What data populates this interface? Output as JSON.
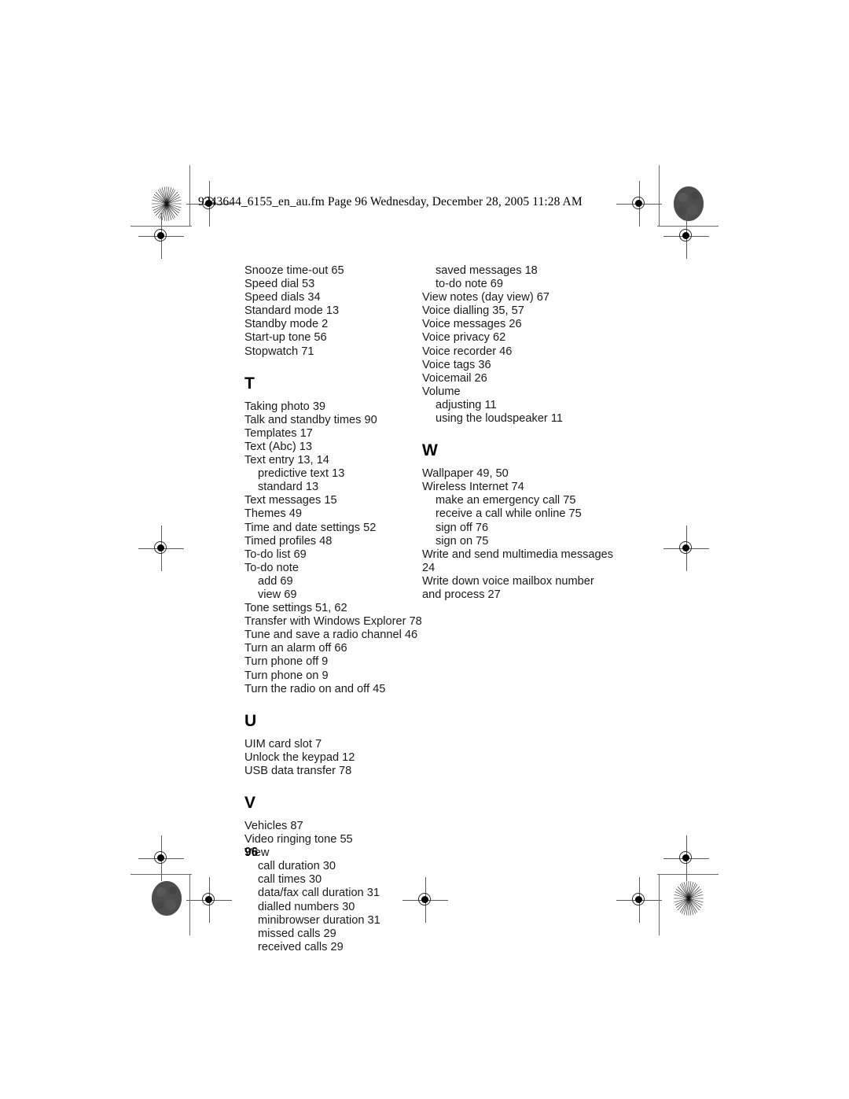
{
  "slug": "9243644_6155_en_au.fm  Page 96  Wednesday, December 28, 2005  11:28 AM",
  "folio": "96",
  "columns": {
    "left": [
      {
        "type": "entry",
        "text": "Snooze time-out 65"
      },
      {
        "type": "entry",
        "text": "Speed dial 53"
      },
      {
        "type": "entry",
        "text": "Speed dials 34"
      },
      {
        "type": "entry",
        "text": "Standard mode 13"
      },
      {
        "type": "entry",
        "text": "Standby mode 2"
      },
      {
        "type": "entry",
        "text": "Start-up tone 56"
      },
      {
        "type": "entry",
        "text": "Stopwatch 71"
      },
      {
        "type": "heading",
        "text": "T"
      },
      {
        "type": "entry",
        "text": "Taking photo 39"
      },
      {
        "type": "entry",
        "text": "Talk and standby times 90"
      },
      {
        "type": "entry",
        "text": "Templates 17"
      },
      {
        "type": "entry",
        "text": "Text (Abc) 13"
      },
      {
        "type": "entry",
        "text": "Text entry 13, 14"
      },
      {
        "type": "sub",
        "text": "predictive text 13"
      },
      {
        "type": "sub",
        "text": "standard 13"
      },
      {
        "type": "entry",
        "text": "Text messages 15"
      },
      {
        "type": "entry",
        "text": "Themes 49"
      },
      {
        "type": "entry",
        "text": "Time and date settings 52"
      },
      {
        "type": "entry",
        "text": "Timed profiles 48"
      },
      {
        "type": "entry",
        "text": "To-do list 69"
      },
      {
        "type": "entry",
        "text": "To-do note"
      },
      {
        "type": "sub",
        "text": "add 69"
      },
      {
        "type": "sub",
        "text": "view 69"
      },
      {
        "type": "entry",
        "text": "Tone settings 51, 62"
      },
      {
        "type": "entry",
        "text": "Transfer with Windows Explorer 78"
      },
      {
        "type": "entry",
        "text": "Tune and save a radio channel 46"
      },
      {
        "type": "entry",
        "text": "Turn an alarm off 66"
      },
      {
        "type": "entry",
        "text": "Turn phone off 9"
      },
      {
        "type": "entry",
        "text": "Turn phone on 9"
      },
      {
        "type": "entry",
        "text": "Turn the radio on and off 45"
      },
      {
        "type": "heading",
        "text": "U"
      },
      {
        "type": "entry",
        "text": "UIM card slot 7"
      },
      {
        "type": "entry",
        "text": "Unlock the keypad 12"
      },
      {
        "type": "entry",
        "text": "USB data transfer 78"
      },
      {
        "type": "heading",
        "text": "V"
      },
      {
        "type": "entry",
        "text": "Vehicles 87"
      },
      {
        "type": "entry",
        "text": "Video ringing tone 55"
      },
      {
        "type": "entry",
        "text": "View"
      },
      {
        "type": "sub",
        "text": "call duration 30"
      },
      {
        "type": "sub",
        "text": "call times 30"
      },
      {
        "type": "sub",
        "text": "data/fax call duration 31"
      },
      {
        "type": "sub",
        "text": "dialled numbers 30"
      },
      {
        "type": "sub",
        "text": "minibrowser duration 31"
      },
      {
        "type": "sub",
        "text": "missed calls 29"
      },
      {
        "type": "sub",
        "text": "received calls 29"
      }
    ],
    "right": [
      {
        "type": "sub",
        "text": "saved messages 18"
      },
      {
        "type": "sub",
        "text": "to-do note 69"
      },
      {
        "type": "entry",
        "text": "View notes (day view) 67"
      },
      {
        "type": "entry",
        "text": "Voice dialling 35, 57"
      },
      {
        "type": "entry",
        "text": "Voice messages 26"
      },
      {
        "type": "entry",
        "text": "Voice privacy 62"
      },
      {
        "type": "entry",
        "text": "Voice recorder 46"
      },
      {
        "type": "entry",
        "text": "Voice tags 36"
      },
      {
        "type": "entry",
        "text": "Voicemail 26"
      },
      {
        "type": "entry",
        "text": "Volume"
      },
      {
        "type": "sub",
        "text": "adjusting 11"
      },
      {
        "type": "sub",
        "text": "using the loudspeaker 11"
      },
      {
        "type": "heading",
        "text": "W"
      },
      {
        "type": "entry",
        "text": "Wallpaper 49, 50"
      },
      {
        "type": "entry",
        "text": "Wireless Internet 74"
      },
      {
        "type": "sub",
        "text": "make an emergency call 75"
      },
      {
        "type": "sub",
        "text": "receive a call while online 75"
      },
      {
        "type": "sub",
        "text": "sign off 76"
      },
      {
        "type": "sub",
        "text": "sign on 75"
      },
      {
        "type": "wrap",
        "text": "Write and send multimedia messages 24"
      },
      {
        "type": "wrap",
        "text": "Write down voice mailbox number and process 27"
      }
    ]
  },
  "marks": {
    "registration_icon": "registration-target",
    "starburst_icon": "starburst-density-mark",
    "disc_icon": "solid-density-mark"
  }
}
